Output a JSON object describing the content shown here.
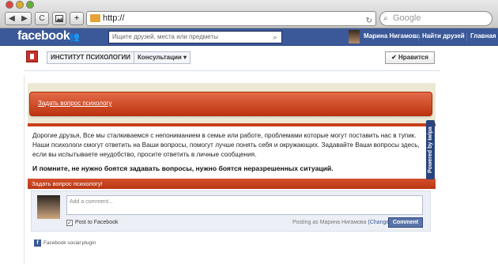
{
  "browser": {
    "url": "http://",
    "search_placeholder": "Google",
    "back_arrow": "◀",
    "forward_arrow": "▶",
    "reload_glyph": "C",
    "addtab_glyph": "+"
  },
  "facebook_bar": {
    "logo": "facebook",
    "search_placeholder": "Ищите друзей, места или предметы",
    "user_name": "Марина Нигамова",
    "find_friends": "Найти друзей",
    "home": "Главная"
  },
  "page_header": {
    "breadcrumb": [
      "ИНСТИТУТ ПСИХОЛОГИИ",
      "Консультации ▾"
    ],
    "like_button": "✔ Нравится"
  },
  "app": {
    "ask_button": "Задать вопрос психологу",
    "intro_text": "Дорогие друзья, Все мы сталкиваемся с непониманием в семье или работе, проблемами которые могут поставить нас в тупик. Наши психологи смогут ответить на Ваши вопросы, помогут лучше понять себя и окружающих. Задавайте Ваши вопросы здесь, если вы испытываете неудобство, просите ответить в личные сообщения.",
    "bold_text": "И помните, не нужно боятся задавать вопросы, нужно боятся неразрешенных ситуаций.",
    "ask_bar": "Задать вопрос психологу!",
    "comment_placeholder": "Add a comment...",
    "post_to_facebook": "Post to Facebook",
    "posting_as": "Posting as Марина Нигамова",
    "change_link": "(Change)",
    "comment_button": "Comment",
    "plugin_text": "Facebook social plugin",
    "powered_by": "Powered by iwipa"
  },
  "colors": {
    "facebook_blue": "#3b5998",
    "accent_orange": "#d2502b",
    "beige": "#ede8d3"
  }
}
